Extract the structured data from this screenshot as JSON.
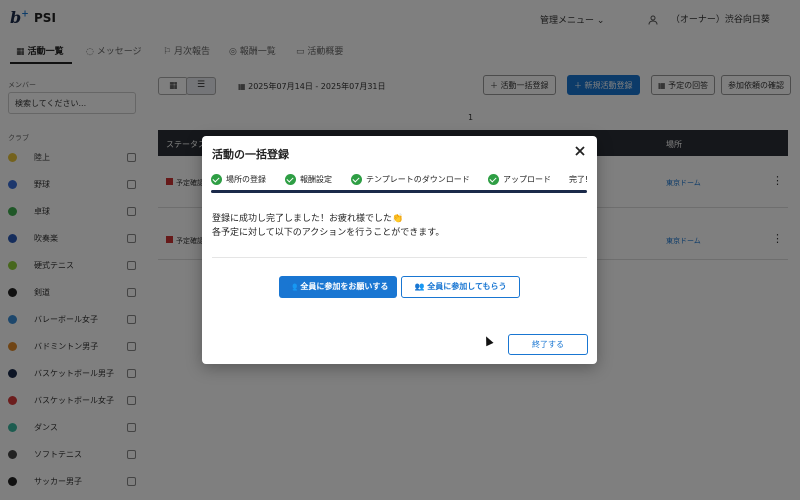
{
  "header": {
    "logo_text": "b",
    "app_name": "PSI",
    "management_menu": "管理メニュー",
    "user_name": "（オーナー）渋谷向日葵"
  },
  "tabs": [
    {
      "label": "活動一覧",
      "icon": "calendar-icon"
    },
    {
      "label": "メッセージ",
      "icon": "chat-icon"
    },
    {
      "label": "月次報告",
      "icon": "flag-icon"
    },
    {
      "label": "報酬一覧",
      "icon": "money-icon"
    },
    {
      "label": "活動概要",
      "icon": "monitor-icon"
    }
  ],
  "sidebar": {
    "member_label": "メンバー",
    "member_select_placeholder": "検索してください...",
    "club_label": "クラブ",
    "clubs": [
      {
        "name": "陸上",
        "color": "#e8c53a"
      },
      {
        "name": "野球",
        "color": "#3a6fd8"
      },
      {
        "name": "卓球",
        "color": "#3fae4f"
      },
      {
        "name": "吹奏楽",
        "color": "#2a5ab8"
      },
      {
        "name": "硬式テニス",
        "color": "#8fce3a"
      },
      {
        "name": "剣道",
        "color": "#222222"
      },
      {
        "name": "バレーボール女子",
        "color": "#3a8fd8"
      },
      {
        "name": "バドミントン男子",
        "color": "#e08a2a"
      },
      {
        "name": "バスケットボール男子",
        "color": "#1b2a4a"
      },
      {
        "name": "バスケットボール女子",
        "color": "#d83a3a"
      },
      {
        "name": "ダンス",
        "color": "#3ab8a0"
      },
      {
        "name": "ソフトテニス",
        "color": "#444444"
      },
      {
        "name": "サッカー男子",
        "color": "#222222"
      }
    ]
  },
  "toolbar": {
    "date_range": "2025年07月14日 - 2025年07月31日",
    "bulk_register": "＋ 活動一括登録",
    "new_activity": "＋ 新規活動登録",
    "schedule_answer": "予定の回答",
    "confirm_request": "参加依頼の確認",
    "page_number": "1"
  },
  "table": {
    "status_header": "ステータス",
    "place_header": "場所",
    "rows": [
      {
        "status": "予定確認",
        "place": "東京ドーム"
      },
      {
        "status": "予定確認",
        "place": "東京ドーム"
      }
    ]
  },
  "modal": {
    "title": "活動の一括登録",
    "steps": [
      "場所の登録",
      "報酬設定",
      "テンプレートのダウンロード",
      "アップロード",
      "完了!"
    ],
    "message_line1": "登録に成功し完了しました！お疲れ様でした👏",
    "message_line2": "各予定に対して以下のアクションを行うことができます。",
    "request_all_button": "全員に参加をお願いする",
    "join_all_button": "全員に参加してもらう",
    "finish_button": "終了する"
  },
  "colors": {
    "primary": "#1976d2",
    "success": "#2e9e44",
    "dark": "#1b2a4a"
  }
}
